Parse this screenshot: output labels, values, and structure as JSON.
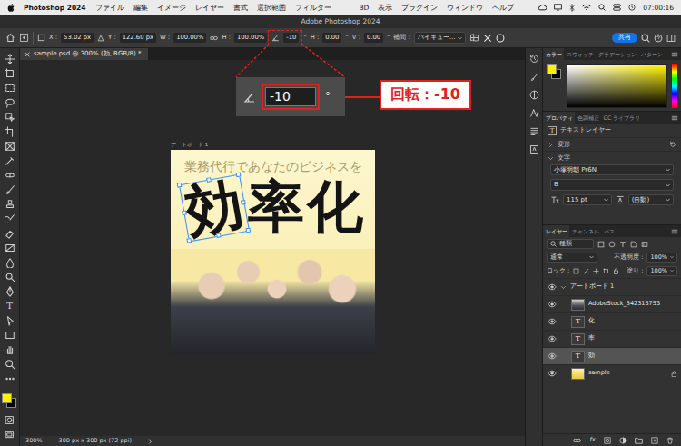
{
  "menubar": {
    "app": "Photoshop 2024",
    "menus_left": [
      "ファイル",
      "編集",
      "イメージ",
      "レイヤー",
      "書式",
      "選択範囲",
      "フィルター"
    ],
    "menus_right": [
      "3D",
      "表示",
      "プラグイン",
      "ウィンドウ",
      "ヘルプ"
    ],
    "clock": "07:00:16"
  },
  "window": {
    "title": "Adobe Photoshop 2024"
  },
  "options_bar": {
    "position": [
      {
        "label": "X :",
        "value": "53.02 px"
      },
      {
        "label": "Y :",
        "value": "122.60 px"
      }
    ],
    "size": [
      {
        "label": "W :",
        "value": "100.00%"
      },
      {
        "label": "H :",
        "value": "100.00%"
      }
    ],
    "angle": {
      "value": "-10",
      "unit": "°"
    },
    "skew": [
      {
        "label": "H :",
        "value": "0.00",
        "unit": "°"
      },
      {
        "label": "V :",
        "value": "0.00",
        "unit": "°"
      }
    ],
    "interpolation": {
      "label": "補間 :",
      "value": "バイキュー..."
    },
    "share": "共有"
  },
  "document_tab": {
    "title": "sample.psd @ 300% (効, RGB/8) *",
    "selected": true
  },
  "toolbar": {
    "type_glyph": "T",
    "foreground": "#fff200",
    "background": "#000000"
  },
  "canvas": {
    "artboard_label": "アートボード 1",
    "subtitle": "業務代行であなたのビジネスを",
    "headline": [
      {
        "char": "効",
        "selected": true
      },
      {
        "char": "率",
        "selected": false
      },
      {
        "char": "化",
        "selected": false
      }
    ]
  },
  "annotation": {
    "value": "-10",
    "unit": "°",
    "label": "回転：-10"
  },
  "status_bar": {
    "zoom": "300%",
    "info": "300 px x 300 px (72 ppi)"
  },
  "panels": {
    "color": {
      "tabs": [
        {
          "label": "カラー",
          "selected": true
        },
        {
          "label": "スウォッチ",
          "selected": false
        },
        {
          "label": "グラデーション",
          "selected": false
        },
        {
          "label": "パターン",
          "selected": false
        }
      ]
    },
    "properties": {
      "tabs": [
        {
          "label": "プロパティ",
          "selected": true
        },
        {
          "label": "色調補正",
          "selected": false
        },
        {
          "label": "CC ライブラリ",
          "selected": false
        }
      ],
      "type_icon": "T",
      "layer_type": "テキストレイヤー",
      "sections": [
        {
          "label": "変形",
          "expanded": false
        },
        {
          "label": "文字",
          "expanded": true
        }
      ],
      "font": "小塚明朝 Pr6N",
      "style": "B",
      "size": "115 pt",
      "leading": "(自動)"
    },
    "layers": {
      "tabs": [
        {
          "label": "レイヤー",
          "selected": true
        },
        {
          "label": "チャンネル",
          "selected": false
        },
        {
          "label": "パス",
          "selected": false
        }
      ],
      "filter": "種類",
      "blend": "通常",
      "opacity_label": "不透明度 :",
      "opacity": "100%",
      "lock_label": "ロック :",
      "fill_label": "塗り :",
      "fill": "100%",
      "fx": "fx",
      "items": [
        {
          "name": "アートボード 1",
          "kind": "artboard",
          "visible": true,
          "expanded": true,
          "selected": false,
          "locked": false,
          "children": [
            {
              "name": "AdobeStock_542313753",
              "kind": "smart",
              "visible": true,
              "selected": false,
              "locked": false
            },
            {
              "name": "化",
              "kind": "text",
              "thumb": "T",
              "visible": true,
              "selected": false,
              "locked": false
            },
            {
              "name": "率",
              "kind": "text",
              "thumb": "T",
              "visible": true,
              "selected": false,
              "locked": false
            },
            {
              "name": "効",
              "kind": "text",
              "thumb": "T",
              "visible": true,
              "selected": true,
              "locked": false
            },
            {
              "name": "sample",
              "kind": "image",
              "visible": true,
              "selected": false,
              "locked": true
            }
          ]
        }
      ]
    }
  }
}
